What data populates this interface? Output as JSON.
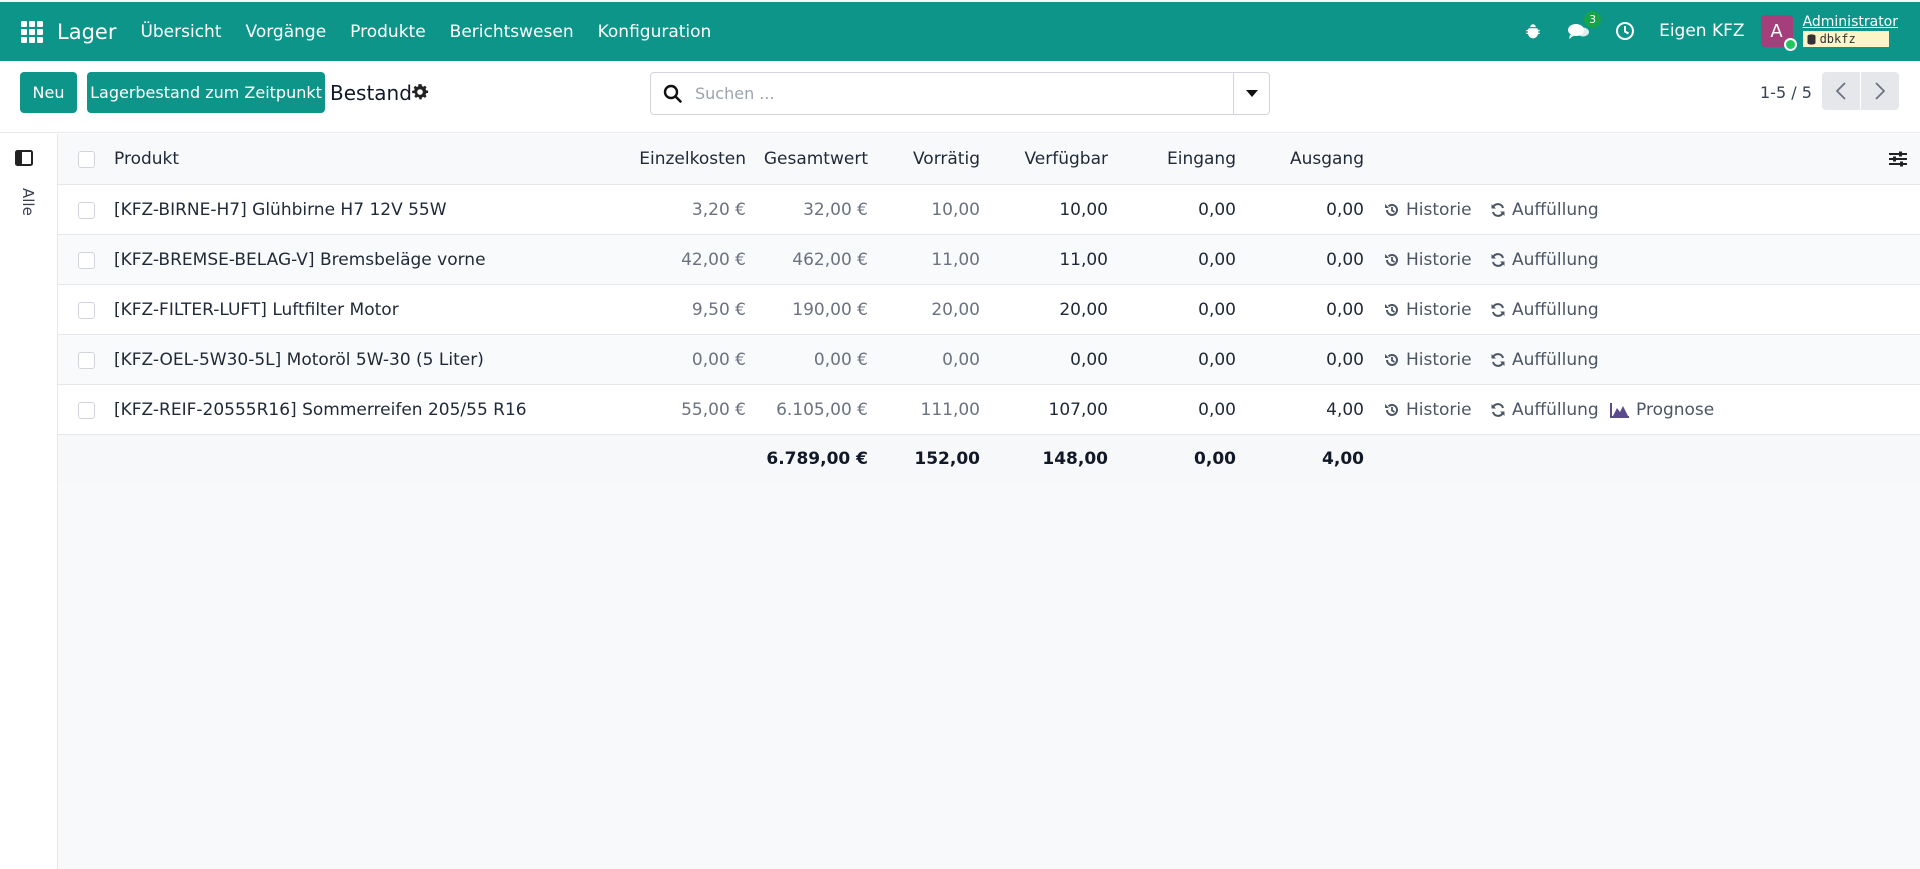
{
  "navbar": {
    "app_name": "Lager",
    "menu": [
      "Übersicht",
      "Vorgänge",
      "Produkte",
      "Berichtswesen",
      "Konfiguration"
    ],
    "messages_badge": "3",
    "company": "Eigen KFZ",
    "avatar_letter": "A",
    "user_name": "Administrator",
    "database": "dbkfz",
    "color": "#0e958a"
  },
  "control_panel": {
    "new_button": "Neu",
    "stock_at_date_button": "Lagerbestand zum Zeitpunkt",
    "title": "Bestand",
    "search_placeholder": "Suchen ...",
    "pager": "1-5 / 5"
  },
  "sidebar": {
    "label": "Alle"
  },
  "table": {
    "columns": [
      "Produkt",
      "Einzelkosten",
      "Gesamtwert",
      "Vorrätig",
      "Verfügbar",
      "Eingang",
      "Ausgang"
    ],
    "rows": [
      {
        "product": "[KFZ-BIRNE-H7] Glühbirne H7 12V 55W",
        "unit_cost": "3,20 €",
        "total_value": "32,00 €",
        "on_hand": "10,00",
        "available": "10,00",
        "incoming": "0,00",
        "outgoing": "0,00",
        "history": "Historie",
        "replenish": "Auffüllung",
        "forecast": ""
      },
      {
        "product": "[KFZ-BREMSE-BELAG-V] Bremsbeläge vorne",
        "unit_cost": "42,00 €",
        "total_value": "462,00 €",
        "on_hand": "11,00",
        "available": "11,00",
        "incoming": "0,00",
        "outgoing": "0,00",
        "history": "Historie",
        "replenish": "Auffüllung",
        "forecast": ""
      },
      {
        "product": "[KFZ-FILTER-LUFT] Luftfilter Motor",
        "unit_cost": "9,50 €",
        "total_value": "190,00 €",
        "on_hand": "20,00",
        "available": "20,00",
        "incoming": "0,00",
        "outgoing": "0,00",
        "history": "Historie",
        "replenish": "Auffüllung",
        "forecast": ""
      },
      {
        "product": "[KFZ-OEL-5W30-5L] Motoröl 5W-30 (5 Liter)",
        "unit_cost": "0,00 €",
        "total_value": "0,00 €",
        "on_hand": "0,00",
        "available": "0,00",
        "incoming": "0,00",
        "outgoing": "0,00",
        "history": "Historie",
        "replenish": "Auffüllung",
        "forecast": ""
      },
      {
        "product": "[KFZ-REIF-20555R16] Sommerreifen 205/55 R16",
        "unit_cost": "55,00 €",
        "total_value": "6.105,00 €",
        "on_hand": "111,00",
        "available": "107,00",
        "incoming": "0,00",
        "outgoing": "4,00",
        "history": "Historie",
        "replenish": "Auffüllung",
        "forecast": "Prognose"
      }
    ],
    "totals": {
      "total_value": "6.789,00 €",
      "on_hand": "152,00",
      "available": "148,00",
      "incoming": "0,00",
      "outgoing": "4,00"
    }
  }
}
